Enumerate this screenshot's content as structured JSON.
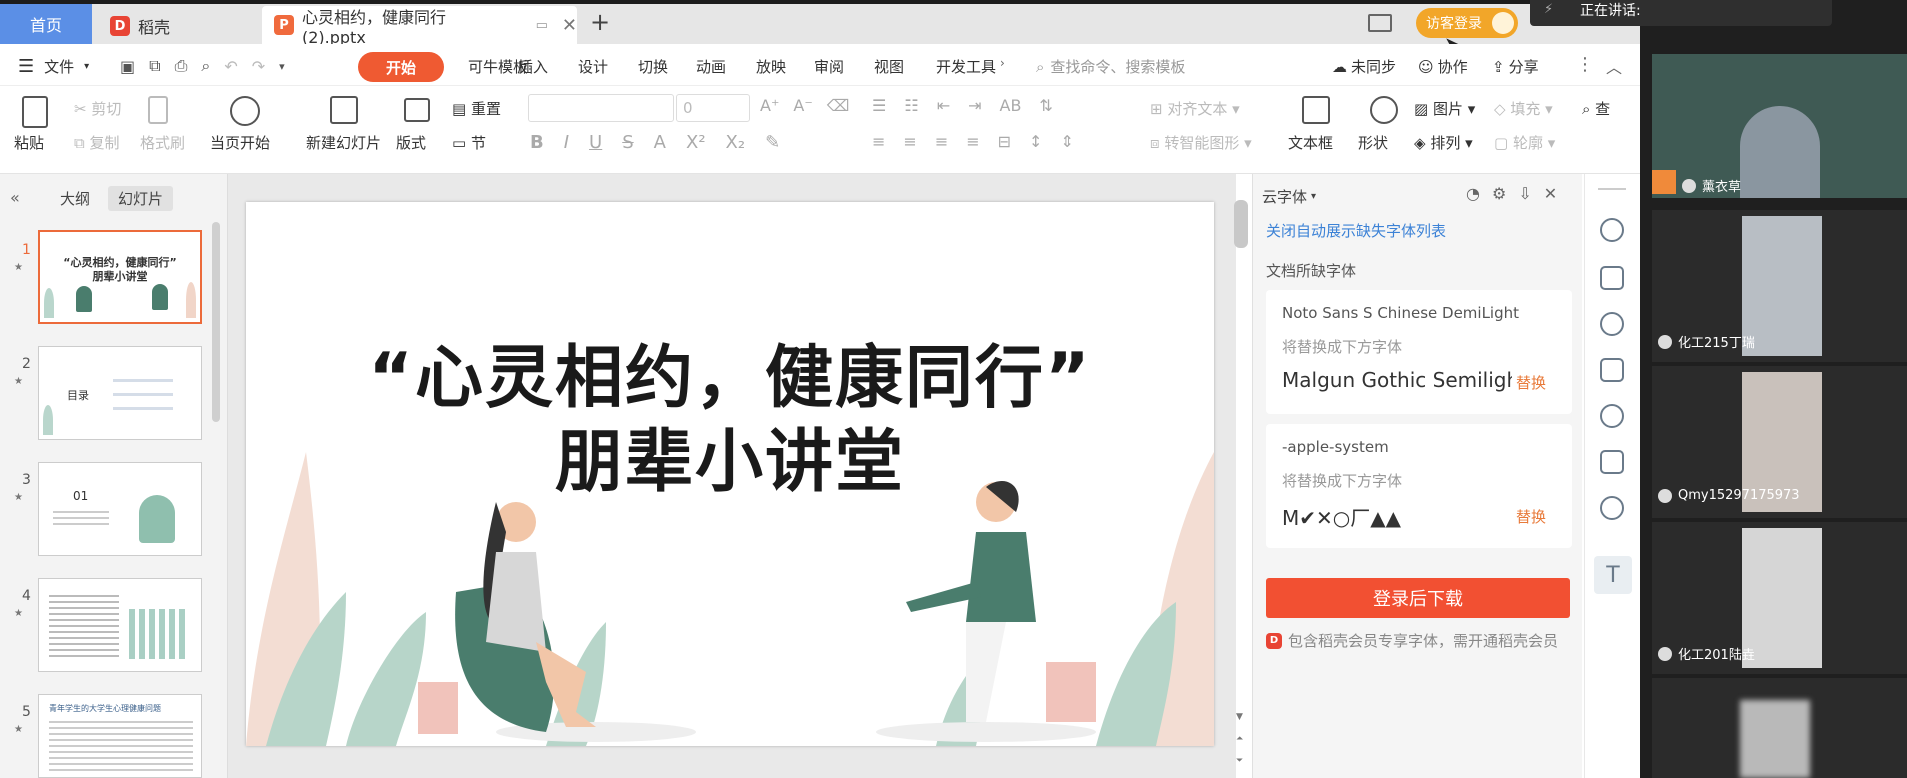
{
  "tabs": {
    "home": "首页",
    "daoke": "稻壳",
    "document": "心灵相约，健康同行(2).pptx",
    "visitor_login": "访客登录"
  },
  "menu": {
    "file": "文件",
    "items": [
      "开始",
      "可牛模板",
      "插入",
      "设计",
      "切换",
      "动画",
      "放映",
      "审阅",
      "视图",
      "开发工具"
    ],
    "search_placeholder": "查找命令、搜索模板",
    "unsync": "未同步",
    "collab": "协作",
    "share": "分享"
  },
  "ribbon": {
    "paste": "粘贴",
    "cut": "剪切",
    "copy": "复制",
    "format_painter": "格式刷",
    "from_current": "当页开始",
    "new_slide": "新建幻灯片",
    "layout": "版式",
    "reset": "重置",
    "section": "节",
    "font_size": "0",
    "align_text": "对齐文本",
    "smart_shape": "转智能图形",
    "textbox": "文本框",
    "shape": "形状",
    "picture": "图片",
    "arrange": "排列",
    "fill": "填充",
    "outline": "轮廓",
    "find": "查"
  },
  "left_panel": {
    "outline_tab": "大纲",
    "slides_tab": "幻灯片",
    "slide_numbers": [
      "1",
      "2",
      "3",
      "4",
      "5"
    ],
    "thumb1_title": "“心灵相约，健康同行”",
    "thumb1_sub": "朋辈小讲堂",
    "thumb2_label": "目录",
    "thumb3_num": "01",
    "thumb5_title": "青年学生的大学生心理健康问题"
  },
  "slide": {
    "title_line1": "“心灵相约，健康同行”",
    "title_line2": "朋辈小讲堂"
  },
  "font_panel": {
    "header": "云字体",
    "close_auto_list": "关闭自动展示缺失字体列表",
    "missing_fonts": "文档所缺字体",
    "fonts": [
      {
        "missing": "Noto Sans S Chinese DemiLight",
        "hint": "将替换成下方字体",
        "replacement": "Malgun Gothic Semiligh",
        "action": "替换"
      },
      {
        "missing": "-apple-system",
        "hint": "将替换成下方字体",
        "replacement": "M✔✕○厂▲▲",
        "action": "替换"
      }
    ],
    "download_btn": "登录后下载",
    "member_note": "包含稻壳会员专享字体，需开通稻壳会员"
  },
  "video": {
    "speaking": "正在讲话:",
    "participants": [
      "薰衣草",
      "化工215丁瑞",
      "Qmy15297175973",
      "化工201陆垚"
    ]
  },
  "colors": {
    "accent": "#ef5a32",
    "home_tab": "#5b8fe6",
    "visitor": "#f2a629",
    "download": "#f25032"
  }
}
